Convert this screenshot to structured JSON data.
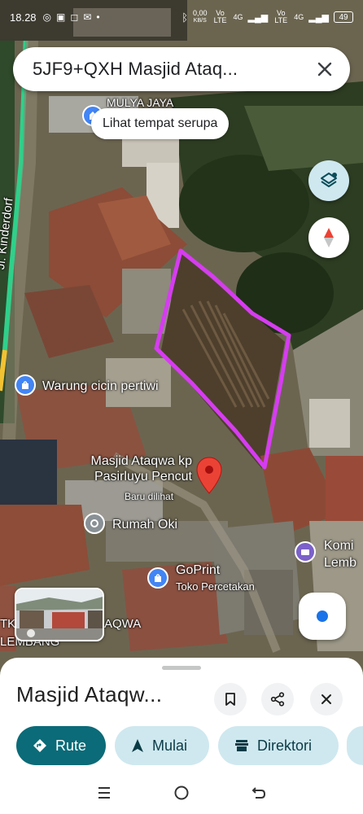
{
  "status_bar": {
    "time": "18.28",
    "net_speed": "0,00",
    "net_unit": "KB/S",
    "sim1": "Vo LTE",
    "sim1_net": "4G",
    "sim2": "Vo LTE",
    "sim2_net": "4G",
    "battery": "49"
  },
  "search": {
    "query": "5JF9+QXH Masjid Ataq..."
  },
  "tooltip": "Lihat tempat serupa",
  "map_labels": {
    "top_place": "MULYA JAYA",
    "street": "Jl. Kinderdorf",
    "warung": "Warung cicin pertiwi",
    "masjid_line1": "Masjid Ataqwa kp",
    "masjid_line2": "Pasirluyu Pencut",
    "recent": "Baru dilihat",
    "rumah": "Rumah Oki",
    "goprint": "GoPrint",
    "goprint_sub": "Toko Percetakan",
    "komi_line1": "Komi",
    "komi_line2": "Lemb",
    "bottom_left_1": "TK",
    "bottom_left_2": "AQWA",
    "bottom_left_3": "LEMBANG"
  },
  "sheet": {
    "title": "Masjid Ataqw...",
    "chips": {
      "route": "Rute",
      "start": "Mulai",
      "directory": "Direktori"
    }
  },
  "colors": {
    "primary_chip": "#0b6b78",
    "secondary_chip": "#cfe8ef",
    "boundary": "#d63cf0",
    "pin": "#ea4335"
  }
}
